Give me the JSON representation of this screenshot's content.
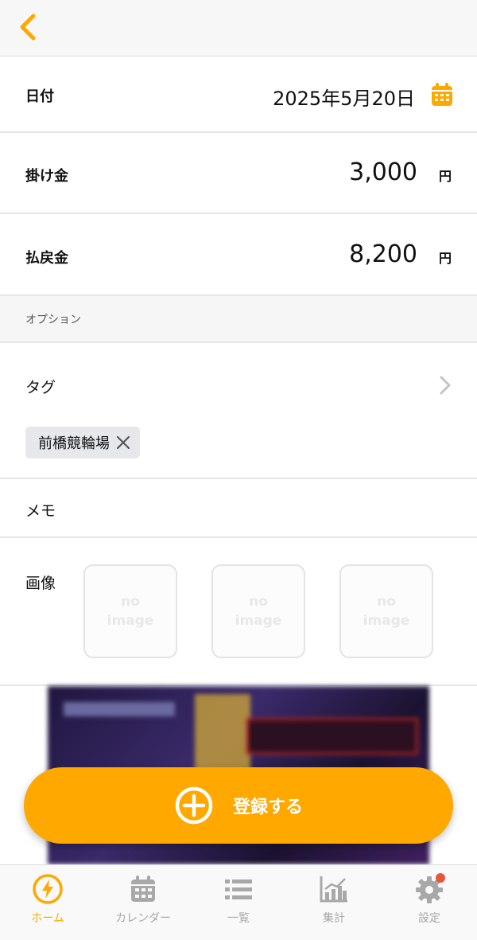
{
  "date": {
    "label": "日付",
    "value": "2025年5月20日"
  },
  "bet": {
    "label": "掛け金",
    "value": "3,000",
    "unit": "円"
  },
  "payout": {
    "label": "払戻金",
    "value": "8,200",
    "unit": "円"
  },
  "options_header": "オプション",
  "tag": {
    "label": "タグ",
    "chip": "前橋競輪場"
  },
  "memo": {
    "label": "メモ"
  },
  "image": {
    "label": "画像",
    "placeholders": [
      {
        "line1": "no",
        "line2": "image"
      },
      {
        "line1": "no",
        "line2": "image"
      },
      {
        "line1": "no",
        "line2": "image"
      }
    ]
  },
  "register_button": "登録する",
  "tabs": [
    {
      "label": "ホーム",
      "icon": "lightning-icon",
      "active": true
    },
    {
      "label": "カレンダー",
      "icon": "calendar-icon"
    },
    {
      "label": "一覧",
      "icon": "list-icon"
    },
    {
      "label": "集計",
      "icon": "chart-icon"
    },
    {
      "label": "設定",
      "icon": "gear-icon",
      "badge": true
    }
  ],
  "colors": {
    "accent": "#ffa800",
    "badge": "#e8553b",
    "inactive": "#a8a8a8"
  }
}
